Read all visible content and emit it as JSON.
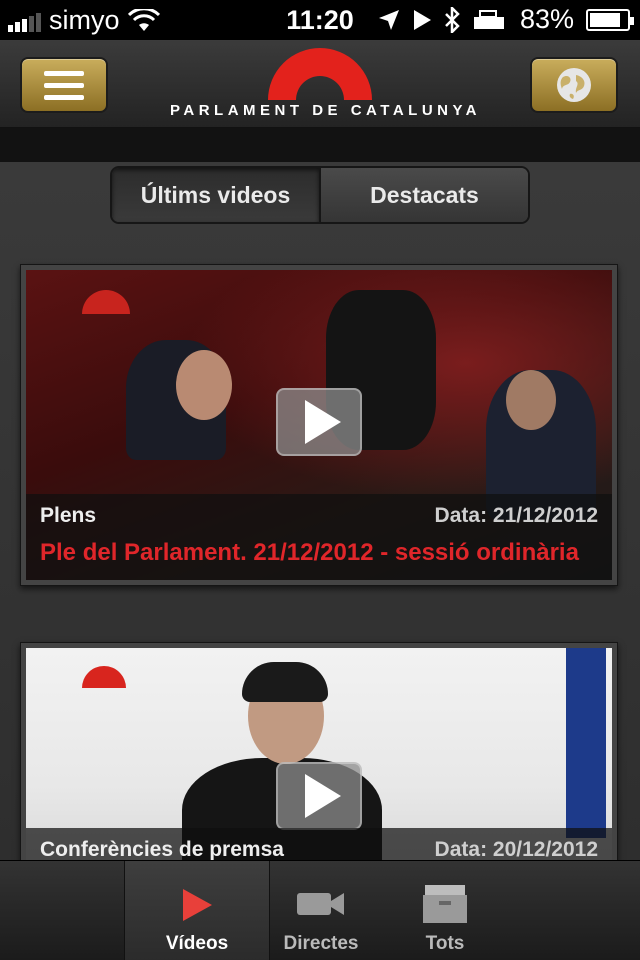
{
  "status_bar": {
    "carrier": "simyo",
    "time": "11:20",
    "battery_percent": "83%"
  },
  "header": {
    "menu_icon": "hamburger-menu-icon",
    "globe_icon": "globe-icon",
    "logo_text": "PARLAMENT DE CATALUNYA",
    "logo_color": "#e3221c",
    "button_color": "#b29543"
  },
  "segments": {
    "latest_label": "Últims videos",
    "featured_label": "Destacats"
  },
  "videos": [
    {
      "category": "Plens",
      "date": "Data: 21/12/2012",
      "title": "Ple del Parlament. 21/12/2012 - sessió ordinària"
    },
    {
      "category": "Conferències de premsa",
      "date": "Data: 20/12/2012",
      "title": ""
    }
  ],
  "tabbar": {
    "videos_label": "Vídeos",
    "live_label": "Directes",
    "all_label": "Tots",
    "accent_color": "#e8403a"
  }
}
